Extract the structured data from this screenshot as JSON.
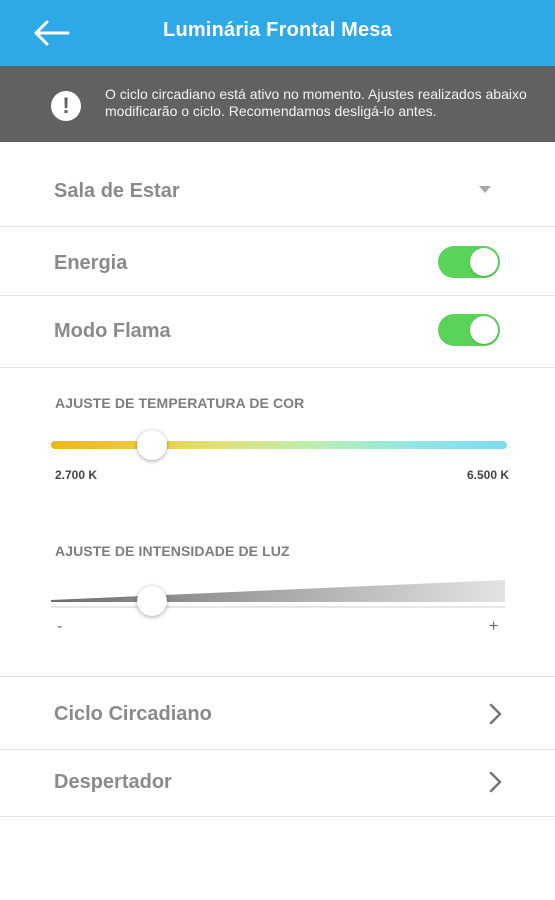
{
  "header": {
    "title": "Luminária Frontal Mesa",
    "back_icon": "arrow-left-icon",
    "color": "#2ea9e6"
  },
  "banner": {
    "icon": "exclamation-icon",
    "text": "O ciclo circadiano está ativo no momento. Ajustes realizados abaixo modificarão o ciclo. Recomendamos desligá-lo antes."
  },
  "room": {
    "label": "Sala de Estar"
  },
  "energy": {
    "label": "Energia",
    "on": true
  },
  "flame": {
    "label": "Modo Flama",
    "on": true
  },
  "temperature": {
    "title": "AJUSTE DE TEMPERATURA DE COR",
    "min_label": "2.700 K",
    "max_label": "6.500 K",
    "value_fraction": 0.22
  },
  "intensity": {
    "title": "AJUSTE DE INTENSIDADE DE LUZ",
    "min_label": "-",
    "max_label": "+",
    "value_fraction": 0.22
  },
  "nav": [
    {
      "label": "Ciclo Circadiano",
      "icon": "chevron-right-icon"
    },
    {
      "label": "Despertador",
      "icon": "chevron-right-icon"
    }
  ],
  "accent_toggle_color": "#5bd35b"
}
